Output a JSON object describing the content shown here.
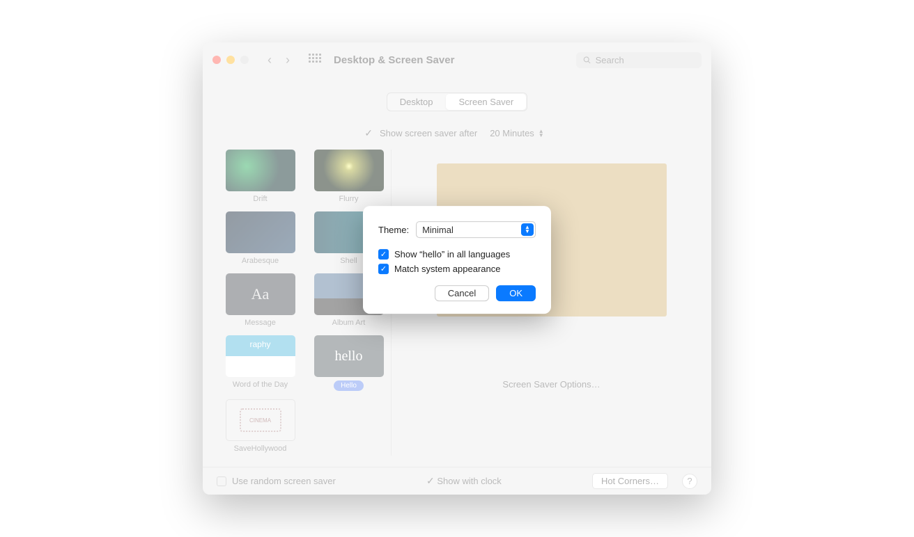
{
  "window": {
    "title": "Desktop & Screen Saver",
    "search_placeholder": "Search"
  },
  "tabs": {
    "desktop": "Desktop",
    "screensaver": "Screen Saver"
  },
  "after": {
    "label": "Show screen saver after",
    "value": "20 Minutes"
  },
  "savers": [
    {
      "name": "Drift"
    },
    {
      "name": "Flurry"
    },
    {
      "name": "Arabesque"
    },
    {
      "name": "Shell"
    },
    {
      "name": "Message"
    },
    {
      "name": "Album Art"
    },
    {
      "name": "Word of the Day"
    },
    {
      "name": "Hello"
    },
    {
      "name": "SaveHollywood"
    }
  ],
  "preview": {
    "options_btn": "Screen Saver Options…"
  },
  "footer": {
    "random": "Use random screen saver",
    "clock": "Show with clock",
    "hot_corners": "Hot Corners…"
  },
  "modal": {
    "theme_label": "Theme:",
    "theme_value": "Minimal",
    "check1": "Show “hello” in all languages",
    "check2": "Match system appearance",
    "cancel": "Cancel",
    "ok": "OK"
  }
}
